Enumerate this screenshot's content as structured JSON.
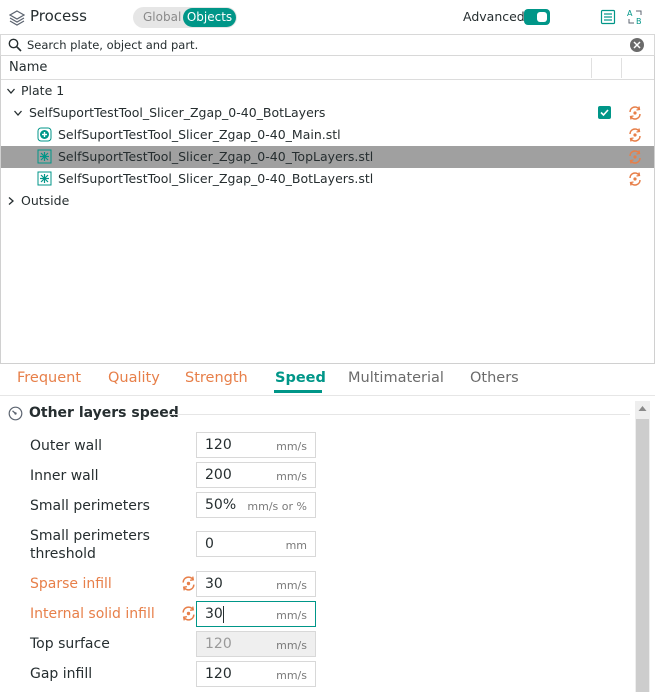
{
  "header": {
    "title": "Process",
    "segment": {
      "global_label": "Global",
      "objects_label": "Objects",
      "selected": "Objects"
    },
    "advanced_label": "Advanced",
    "advanced_enabled": true
  },
  "search": {
    "placeholder": "Search plate, object and part."
  },
  "tree": {
    "column_name": "Name",
    "plate": "Plate 1",
    "object": "SelfSuportTestTool_Slicer_Zgap_0-40_BotLayers",
    "parts": [
      {
        "label": "SelfSuportTestTool_Slicer_Zgap_0-40_Main.stl",
        "icon": "add-part-icon",
        "selected": false
      },
      {
        "label": "SelfSuportTestTool_Slicer_Zgap_0-40_TopLayers.stl",
        "icon": "support-blocker-icon",
        "selected": true
      },
      {
        "label": "SelfSuportTestTool_Slicer_Zgap_0-40_BotLayers.stl",
        "icon": "support-blocker-icon",
        "selected": false
      }
    ],
    "outside": "Outside"
  },
  "tabs": [
    {
      "label": "Frequent",
      "state": "modified"
    },
    {
      "label": "Quality",
      "state": "modified"
    },
    {
      "label": "Strength",
      "state": "modified"
    },
    {
      "label": "Speed",
      "state": "active"
    },
    {
      "label": "Multimaterial",
      "state": "normal"
    },
    {
      "label": "Others",
      "state": "normal"
    }
  ],
  "section": {
    "title": "Other layers speed"
  },
  "params": [
    {
      "label": "Outer wall",
      "value": "120",
      "unit": "mm/s"
    },
    {
      "label": "Inner wall",
      "value": "200",
      "unit": "mm/s"
    },
    {
      "label": "Small perimeters",
      "value": "50%",
      "unit": "mm/s or %"
    },
    {
      "label_line1": "Small perimeters",
      "label_line2": "threshold",
      "value": "0",
      "unit": "mm"
    },
    {
      "label": "Sparse infill",
      "value": "30",
      "unit": "mm/s",
      "modified": true
    },
    {
      "label": "Internal solid infill",
      "value": "30",
      "unit": "mm/s",
      "modified": true,
      "editing": true
    },
    {
      "label": "Top surface",
      "value": "120",
      "unit": "mm/s",
      "disabled": true
    },
    {
      "label": "Gap infill",
      "value": "120",
      "unit": "mm/s"
    }
  ],
  "colors": {
    "accent": "#009688",
    "modified": "#e77f49",
    "selection": "#a0a0a0"
  }
}
